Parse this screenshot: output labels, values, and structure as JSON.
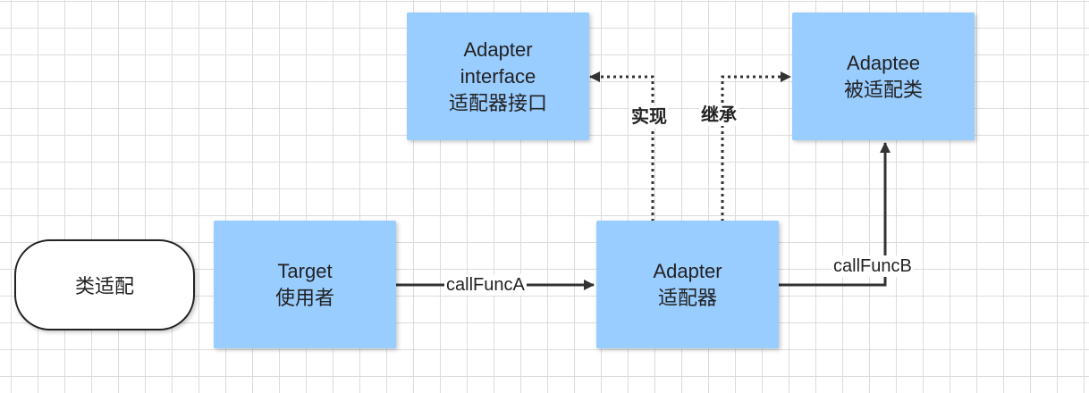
{
  "nodes": {
    "class_adapter": {
      "label": "类适配"
    },
    "target": {
      "line1": "Target",
      "line2": "使用者"
    },
    "adapter": {
      "line1": "Adapter",
      "line2": "适配器"
    },
    "adapter_interface": {
      "line1": "Adapter",
      "line2": "interface",
      "line3": "适配器接口"
    },
    "adaptee": {
      "line1": "Adaptee",
      "line2": "被适配类"
    }
  },
  "edges": {
    "target_to_adapter": {
      "label": "callFuncA",
      "style": "solid"
    },
    "adapter_to_adaptee": {
      "label": "callFuncB",
      "style": "solid"
    },
    "implements": {
      "label": "实现",
      "style": "dotted"
    },
    "inherits": {
      "label": "继承",
      "style": "dotted"
    }
  },
  "colors": {
    "node_fill": "#99ccff",
    "stroke": "#333333",
    "grid": "#dcdcdc"
  }
}
